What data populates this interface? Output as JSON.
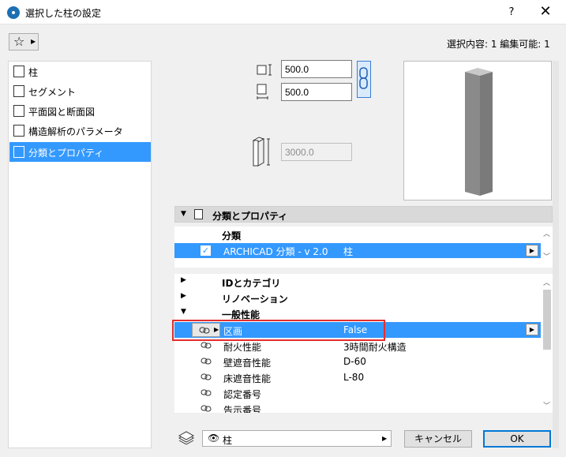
{
  "window": {
    "title": "選択した柱の設定",
    "help_label": "?",
    "close_label": "✕"
  },
  "header": {
    "favorites_icon": "star-icon",
    "selection_info": "選択内容: 1 編集可能: 1"
  },
  "sidebar": {
    "items": [
      {
        "label": "柱",
        "icon": "column-icon",
        "selected": false
      },
      {
        "label": "セグメント",
        "icon": "segment-icon",
        "selected": false
      },
      {
        "label": "平面図と断面図",
        "icon": "floor-plan-icon",
        "selected": false
      },
      {
        "label": "構造解析のパラメータ",
        "icon": "structural-analysis-icon",
        "selected": false
      },
      {
        "label": "分類とプロパティ",
        "icon": "properties-icon",
        "selected": true
      }
    ]
  },
  "dimensions": {
    "width": "500.0",
    "depth": "500.0",
    "height": "3000.0"
  },
  "section": {
    "title": "分類とプロパティ"
  },
  "classification": {
    "header": "分類",
    "row": {
      "checked": true,
      "check_mark": "✓",
      "name": "ARCHICAD 分類 - v 2.0",
      "value": "柱"
    }
  },
  "properties": {
    "groups": [
      {
        "label": "IDとカテゴリ",
        "expanded": false
      },
      {
        "label": "リノベーション",
        "expanded": false
      },
      {
        "label": "一般性能",
        "expanded": true
      }
    ],
    "rows": [
      {
        "name": "区画",
        "value": "False",
        "selected": true
      },
      {
        "name": "耐火性能",
        "value": "3時間耐火構造",
        "selected": false
      },
      {
        "name": "壁遮音性能",
        "value": "D-60",
        "selected": false
      },
      {
        "name": "床遮音性能",
        "value": "L-80",
        "selected": false
      },
      {
        "name": "認定番号",
        "value": "",
        "selected": false
      },
      {
        "name": "告示番号",
        "value": "",
        "selected": false
      }
    ]
  },
  "footer": {
    "layer_label": "柱",
    "cancel_label": "キャンセル",
    "ok_label": "OK"
  },
  "colors": {
    "selection": "#3399ff",
    "highlight": "#e52e2e"
  }
}
